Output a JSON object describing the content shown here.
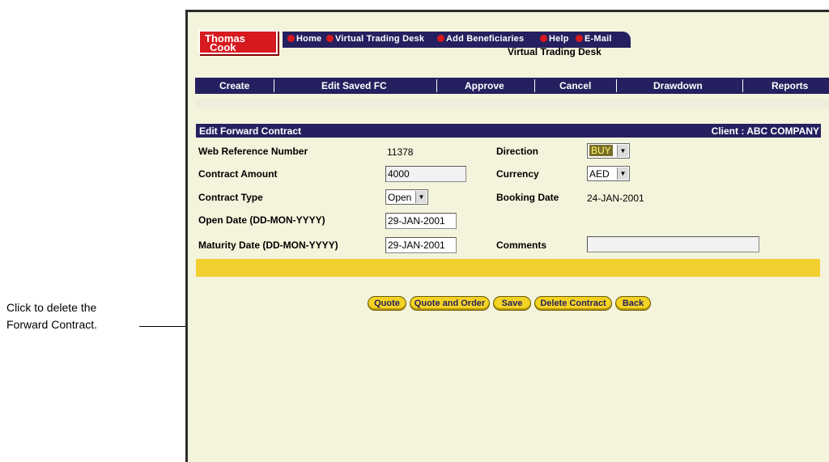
{
  "callout": {
    "line1": "Click to delete the",
    "line2": "Forward Contract."
  },
  "brand": {
    "line1": "Thomas",
    "line2": "Cook"
  },
  "topnav": {
    "tabs": [
      "Home",
      "Virtual Trading Desk",
      "Add Beneficiaries",
      "Help",
      "E-Mail"
    ],
    "subtitle": "Virtual Trading Desk"
  },
  "menu": [
    "Create",
    "Edit Saved FC",
    "Approve",
    "Cancel",
    "Drawdown",
    "Reports"
  ],
  "form": {
    "title": "Edit Forward Contract",
    "client": "Client : ABC COMPANY",
    "web_ref_label": "Web Reference Number",
    "web_ref_value": "11378",
    "direction_label": "Direction",
    "direction_value": "BUY",
    "amount_label": "Contract Amount",
    "amount_value": "4000",
    "currency_label": "Currency",
    "currency_value": "AED",
    "type_label": "Contract Type",
    "type_value": "Open",
    "booking_label": "Booking Date",
    "booking_value": "24-JAN-2001",
    "open_date_label": "Open Date (DD-MON-YYYY)",
    "open_date_value": "29-JAN-2001",
    "maturity_label": "Maturity Date (DD-MON-YYYY)",
    "maturity_value": "29-JAN-2001",
    "comments_label": "Comments",
    "comments_value": ""
  },
  "buttons": [
    "Quote",
    "Quote and Order",
    "Save",
    "Delete Contract",
    "Back"
  ],
  "colors": {
    "navy": "#25205f",
    "red": "#d71920",
    "yellow": "#f0cf2e",
    "background": "#f4f4dc"
  }
}
